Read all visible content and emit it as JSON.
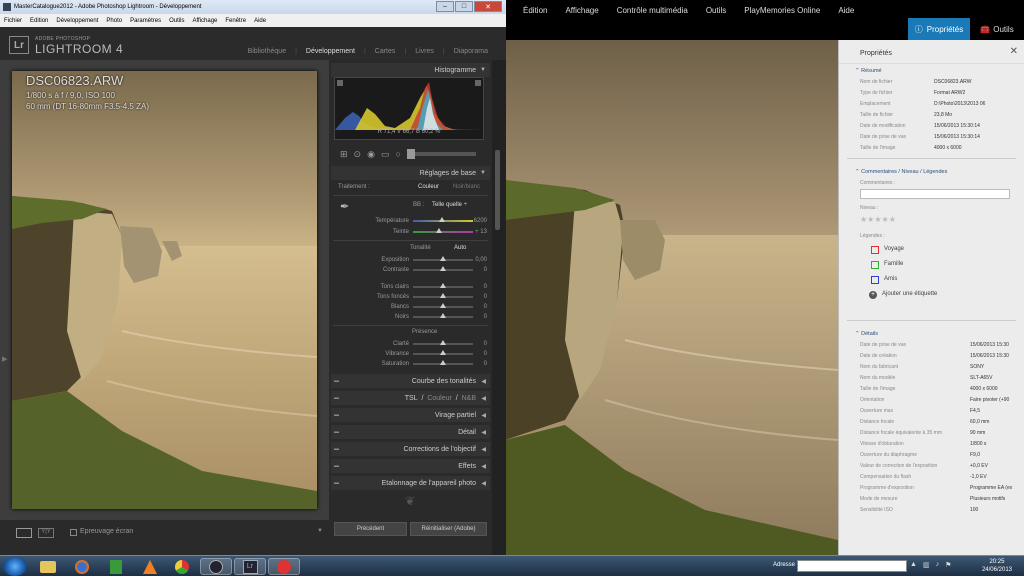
{
  "bg_app": {
    "menu": [
      "Édition",
      "Affichage",
      "Contrôle multimédia",
      "Outils",
      "PlayMemories Online",
      "Aide"
    ],
    "props_button": "Propriétés",
    "tools_button": "Outils",
    "panel": {
      "title": "Propriétés",
      "summary_title": "Résumé",
      "summary": [
        {
          "k": "Nom de fichier",
          "v": "DSC06823.ARW"
        },
        {
          "k": "Type de fichier",
          "v": "Format ARW2"
        },
        {
          "k": "Emplacement",
          "v": "D:\\Photo\\2013\\2013 06"
        },
        {
          "k": "Taille de fichier",
          "v": "23,8 Mo"
        },
        {
          "k": "Date de modification",
          "v": "15/06/2013 15:30:14"
        },
        {
          "k": "Date de prise de vue",
          "v": "15/06/2013 15:30:14"
        },
        {
          "k": "Taille de l'image",
          "v": "4000 x 6000"
        }
      ],
      "comments_title": "Commentaires / Niveau / Légendes",
      "comments_label": "Commentaires :",
      "level_label": "Niveau :",
      "stars": "★★★★★",
      "legends_label": "Légendes :",
      "tags": [
        {
          "label": "Voyage",
          "color": "#e03030"
        },
        {
          "label": "Famille",
          "color": "#30b030"
        },
        {
          "label": "Amis",
          "color": "#3040d0"
        }
      ],
      "add_tag": "Ajouter une étiquette",
      "details_title": "Détails",
      "details": [
        {
          "k": "Date de prise de vue",
          "v": "15/06/2013 15:30"
        },
        {
          "k": "Date de création",
          "v": "15/06/2013 15:30"
        },
        {
          "k": "Nom du fabricant",
          "v": "SONY"
        },
        {
          "k": "Nom du modèle",
          "v": "SLT-A65V"
        },
        {
          "k": "Taille de l'image",
          "v": "4000 x 6000"
        },
        {
          "k": "Orientation",
          "v": "Faire pivoter (+90"
        },
        {
          "k": "Ouverture max",
          "v": "F4,5"
        },
        {
          "k": "Distance focale",
          "v": "60,0 mm"
        },
        {
          "k": "Distance focale équivalente à 35 mm",
          "v": "90 mm"
        },
        {
          "k": "Vitesse d'obturation",
          "v": "1/800 s"
        },
        {
          "k": "Ouverture du diaphragme",
          "v": "F9,0"
        },
        {
          "k": "Valeur de correction de l'exposition",
          "v": "+0,0 EV"
        },
        {
          "k": "Compensation du flash",
          "v": "-1,0 EV"
        },
        {
          "k": "Programme d'exposition",
          "v": "Programme EA (ex"
        },
        {
          "k": "Mode de mesure",
          "v": "Plusieurs motifs"
        },
        {
          "k": "Sensibilité ISO",
          "v": "100"
        }
      ]
    }
  },
  "lr": {
    "window_title": "MasterCatalogue2012 - Adobe Photoshop Lightroom - Développement",
    "menu": [
      "Fichier",
      "Edition",
      "Développement",
      "Photo",
      "Paramètres",
      "Outils",
      "Affichage",
      "Fenêtre",
      "Aide"
    ],
    "logo": "Lr",
    "brand_small": "ADOBE PHOTOSHOP",
    "brand": "LIGHTROOM 4",
    "modules": [
      "Bibliothèque",
      "Développement",
      "Cartes",
      "Livres",
      "Diaporama"
    ],
    "active_module": "Développement",
    "photo_info": {
      "filename": "DSC06823.ARW",
      "exposure": "1/800 s à f / 9,0, ISO 100",
      "lens": "60 mm (DT 16-80mm F3.5-4.5 ZA)"
    },
    "histogram": {
      "title": "Histogramme",
      "readout": "R 71,4  V 66,7  B 60,2 %"
    },
    "basic": {
      "title": "Réglages de base",
      "treatment_label": "Traitement :",
      "color": "Couleur",
      "bw": "Noir/blanc",
      "wb_label": "BB :",
      "wb_value": "Telle quelle ÷",
      "temperature": {
        "label": "Température",
        "value": "6200"
      },
      "tint": {
        "label": "Teinte",
        "value": "+ 13"
      },
      "tone_label": "Tonalité",
      "auto": "Auto",
      "exposure": {
        "label": "Exposition",
        "value": "0,00"
      },
      "contrast": {
        "label": "Contraste",
        "value": "0"
      },
      "highlights": {
        "label": "Tons clairs",
        "value": "0"
      },
      "shadows": {
        "label": "Tons foncés",
        "value": "0"
      },
      "whites": {
        "label": "Blancs",
        "value": "0"
      },
      "blacks": {
        "label": "Noirs",
        "value": "0"
      },
      "presence_label": "Présence",
      "clarity": {
        "label": "Clarté",
        "value": "0"
      },
      "vibrance": {
        "label": "Vibrance",
        "value": "0"
      },
      "saturation": {
        "label": "Saturation",
        "value": "0"
      }
    },
    "panels": {
      "tone_curve": "Courbe des tonalités",
      "tsl_a": "TSL",
      "tsl_b": "Couleur",
      "tsl_c": "N&B",
      "split": "Virage partiel",
      "detail": "Détail",
      "lens": "Corrections de l'objectif",
      "effects": "Effets",
      "camera": "Etalonnage de l'appareil photo"
    },
    "bottom": {
      "proof": "Epreuvage écran",
      "previous": "Précédent",
      "reset": "Réinitialiser (Adobe)"
    }
  },
  "taskbar": {
    "address_label": "Adresse",
    "time": "20:25",
    "date": "24/06/2013"
  }
}
